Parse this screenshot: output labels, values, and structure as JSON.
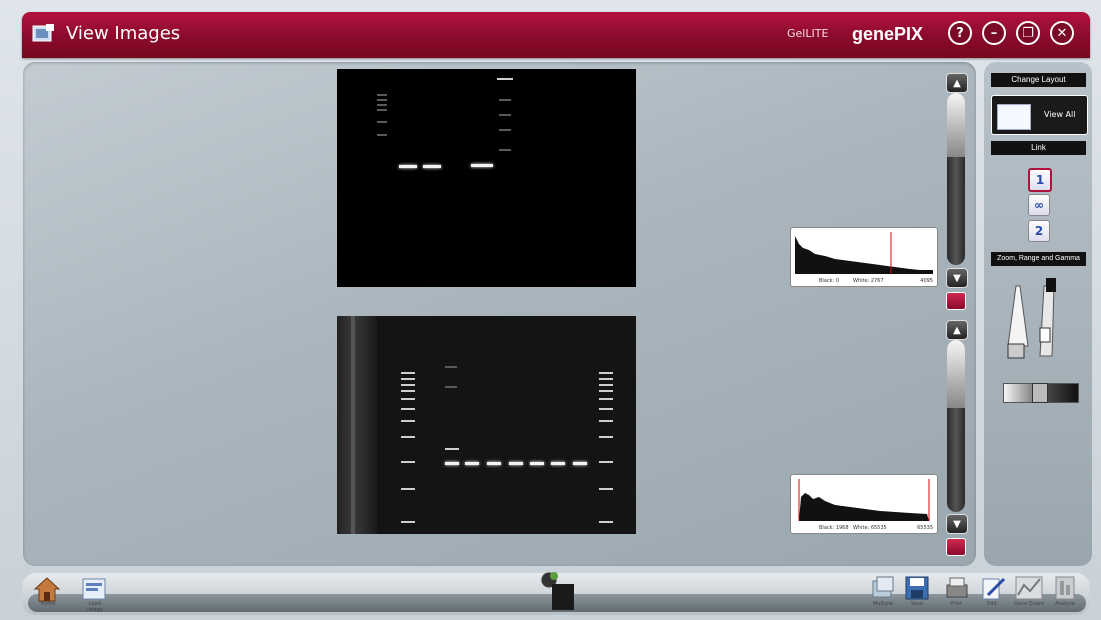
{
  "window": {
    "title": "View Images",
    "edition": "GelLITE",
    "brand": "genePIX",
    "buttons": [
      {
        "name": "help-button",
        "glyph": "?"
      },
      {
        "name": "minimize-button",
        "glyph": "–"
      },
      {
        "name": "restore-button",
        "glyph": "❐"
      },
      {
        "name": "close-button",
        "glyph": "✕"
      }
    ]
  },
  "images": [
    {
      "name": "gel-image-1",
      "histogram": {
        "black": "Black: 0",
        "white": "White: 2767",
        "max": "4095"
      }
    },
    {
      "name": "gel-image-2",
      "histogram": {
        "black": "Black: 1968",
        "white": "White: 65535",
        "max": "65535"
      }
    }
  ],
  "right_panel": {
    "change_layout": "Change Layout",
    "view_all": "View All",
    "link": "Link",
    "link_buttons": [
      "1",
      "∞",
      "2"
    ],
    "zoom_range_gamma": "Zoom, Range and Gamma"
  },
  "toolbar": {
    "home": "Home",
    "load_image": "Load Image",
    "multiple": "Multiple",
    "save": "Save",
    "print": "Print",
    "edit": "Edit",
    "gene_quant": "Gene Quant",
    "analyze": "Analyze"
  },
  "colors": {
    "accent": "#8a0a2c",
    "panel": "#aab5bd"
  }
}
